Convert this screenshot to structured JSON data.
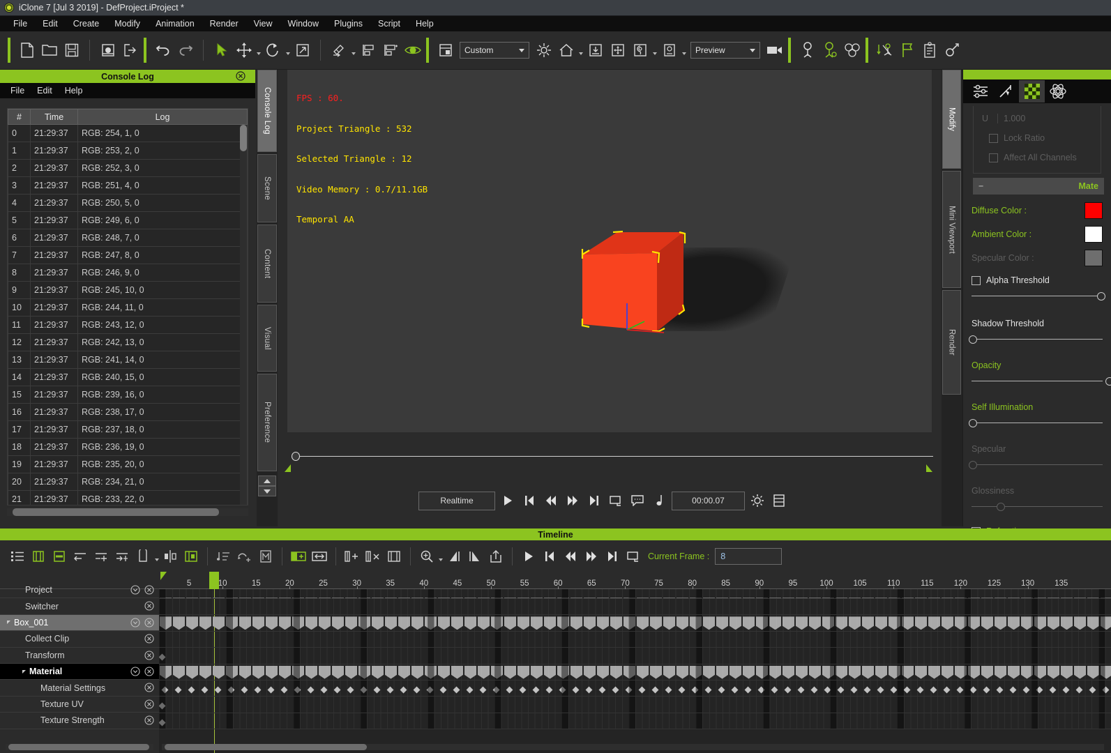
{
  "window": {
    "title": "iClone 7 [Jul  3 2019] - DefProject.iProject *",
    "app_icon": "iclone-logo-icon"
  },
  "menubar": {
    "items": [
      "File",
      "Edit",
      "Create",
      "Modify",
      "Animation",
      "Render",
      "View",
      "Window",
      "Plugins",
      "Script",
      "Help"
    ]
  },
  "toolbar": {
    "groups": [
      {
        "icons": [
          "new-project-icon",
          "open-project-icon",
          "save-project-icon"
        ]
      },
      {
        "icons": [
          "import-icon",
          "export-icon"
        ]
      },
      {
        "icons": [
          "undo-icon",
          "redo-icon"
        ]
      },
      {
        "icons": [
          "select-tool-icon",
          "move-tool-icon",
          "rotate-tool-icon",
          "scale-tool-icon"
        ]
      },
      {
        "icons": [
          "align-icon",
          "align-left-icon",
          "align-right-icon",
          "eye-visibility-icon"
        ]
      },
      {
        "icons": [
          "viewport-layout-icon"
        ]
      }
    ],
    "layout_combo": {
      "value": "Custom",
      "caret": "chevron-down-icon"
    },
    "right_icons": [
      "light-icon",
      "home-icon",
      "ground-icon",
      "move-to-icon",
      "camera-view-icon",
      "object-icon"
    ],
    "quality_combo": {
      "value": "Preview",
      "caret": "chevron-down-icon"
    },
    "camera_icon": "video-camera-icon",
    "tail_icons": [
      "character-icon",
      "character-pose-icon",
      "crowd-icon",
      "motion-puppet-icon",
      "flag-icon",
      "clipboard-icon",
      "edit-motion-icon"
    ]
  },
  "console": {
    "title": "Console Log",
    "close_icon": "close-circle-icon",
    "menu": [
      "File",
      "Edit",
      "Help"
    ],
    "columns": [
      "#",
      "Time",
      "Log"
    ],
    "rows": [
      {
        "n": "0",
        "time": "21:29:37",
        "log": "RGB: 254, 1, 0"
      },
      {
        "n": "1",
        "time": "21:29:37",
        "log": "RGB: 253, 2, 0"
      },
      {
        "n": "2",
        "time": "21:29:37",
        "log": "RGB: 252, 3, 0"
      },
      {
        "n": "3",
        "time": "21:29:37",
        "log": "RGB: 251, 4, 0"
      },
      {
        "n": "4",
        "time": "21:29:37",
        "log": "RGB: 250, 5, 0"
      },
      {
        "n": "5",
        "time": "21:29:37",
        "log": "RGB: 249, 6, 0"
      },
      {
        "n": "6",
        "time": "21:29:37",
        "log": "RGB: 248, 7, 0"
      },
      {
        "n": "7",
        "time": "21:29:37",
        "log": "RGB: 247, 8, 0"
      },
      {
        "n": "8",
        "time": "21:29:37",
        "log": "RGB: 246, 9, 0"
      },
      {
        "n": "9",
        "time": "21:29:37",
        "log": "RGB: 245, 10, 0"
      },
      {
        "n": "10",
        "time": "21:29:37",
        "log": "RGB: 244, 11, 0"
      },
      {
        "n": "11",
        "time": "21:29:37",
        "log": "RGB: 243, 12, 0"
      },
      {
        "n": "12",
        "time": "21:29:37",
        "log": "RGB: 242, 13, 0"
      },
      {
        "n": "13",
        "time": "21:29:37",
        "log": "RGB: 241, 14, 0"
      },
      {
        "n": "14",
        "time": "21:29:37",
        "log": "RGB: 240, 15, 0"
      },
      {
        "n": "15",
        "time": "21:29:37",
        "log": "RGB: 239, 16, 0"
      },
      {
        "n": "16",
        "time": "21:29:37",
        "log": "RGB: 238, 17, 0"
      },
      {
        "n": "17",
        "time": "21:29:37",
        "log": "RGB: 237, 18, 0"
      },
      {
        "n": "18",
        "time": "21:29:37",
        "log": "RGB: 236, 19, 0"
      },
      {
        "n": "19",
        "time": "21:29:37",
        "log": "RGB: 235, 20, 0"
      },
      {
        "n": "20",
        "time": "21:29:37",
        "log": "RGB: 234, 21, 0"
      },
      {
        "n": "21",
        "time": "21:29:37",
        "log": "RGB: 233, 22, 0"
      }
    ]
  },
  "left_tabs": {
    "items": [
      "Console Log",
      "Scene",
      "Content",
      "Visual",
      "Preference"
    ],
    "active": "Console Log",
    "scroll_up_icon": "chevron-up-icon",
    "scroll_down_icon": "chevron-down-icon"
  },
  "viewport": {
    "stats": {
      "fps": "FPS : 60.",
      "project_triangle": "Project Triangle : 532",
      "selected_triangle": "Selected Triangle : 12",
      "video_memory": "Video Memory : 0.7/11.1GB",
      "aa": "Temporal AA"
    },
    "object": {
      "name": "Box_001",
      "face_front_color": "#f9431f",
      "face_top_color": "#e03418",
      "face_right_color": "#c02a14",
      "selection_bracket_color": "#ffe400"
    },
    "gizmo": {
      "x_axis_color": "#e02020",
      "y_axis_color": "#20c020",
      "z_axis_color": "#3040f0"
    }
  },
  "transport": {
    "mode_label": "Realtime",
    "buttons": [
      "play-icon",
      "jump-to-start-icon",
      "step-back-icon",
      "step-forward-icon",
      "jump-to-end-icon",
      "loop-icon",
      "comment-icon",
      "audio-note-icon"
    ],
    "time_value": "00:00.07",
    "settings_icon": "gear-icon",
    "list-icon": "list-icon"
  },
  "right_tabs": {
    "items": [
      "Modify",
      "Mini Viewport",
      "Render"
    ],
    "active": "Modify"
  },
  "right_panel": {
    "icon_tabs": [
      {
        "name": "attribute-icon",
        "active": false
      },
      {
        "name": "animation-icon",
        "active": false
      },
      {
        "name": "material-icon",
        "active": true
      },
      {
        "name": "physics-icon",
        "active": false
      }
    ],
    "uv": {
      "label": "U",
      "value": "1.000"
    },
    "lock_ratio": {
      "label": "Lock Ratio",
      "checked": false,
      "enabled": false
    },
    "affect_all_channels": {
      "label": "Affect All Channels",
      "checked": false,
      "enabled": false
    },
    "material_section": {
      "collapse": "−",
      "title": "Mate"
    },
    "diffuse_color": {
      "label": "Diffuse Color :",
      "color": "#ff0000",
      "enabled": true
    },
    "ambient_color": {
      "label": "Ambient Color :",
      "color": "#ffffff",
      "enabled": true
    },
    "specular_color": {
      "label": "Specular Color :",
      "color": "#6e6e6e",
      "enabled": false
    },
    "alpha_threshold": {
      "label": "Alpha Threshold",
      "checked": false,
      "enabled": true,
      "knob_pct": 100
    },
    "shadow_threshold": {
      "label": "Shadow Threshold",
      "enabled": true,
      "knob_pct": 0
    },
    "opacity": {
      "label": "Opacity",
      "enabled": true,
      "knob_pct": 100
    },
    "self_illumination": {
      "label": "Self Illumination",
      "enabled": true,
      "knob_pct": 0
    },
    "specular": {
      "label": "Specular",
      "enabled": false,
      "knob_pct": 0
    },
    "glossiness": {
      "label": "Glossiness",
      "enabled": false,
      "knob_pct": 24
    },
    "refraction": {
      "label": "Refraction",
      "checked": false,
      "enabled": true
    },
    "accent_green": "#8cc420"
  },
  "timeline": {
    "title": "Timeline",
    "toolbar_left_icons": [
      "track-list-icon",
      "add-track-icon",
      "collapse-track-icon",
      "shift-left-icon",
      "add-key-left-icon",
      "add-key-right-icon",
      "clip-icon",
      "split-clip-icon",
      "clip-region-icon"
    ],
    "toolbar_mid_icons": [
      "sort-keys-icon",
      "unlink-icon",
      "motion-layer-icon"
    ],
    "toolbar_mid2_icons": [
      "add-clip-icon",
      "stretch-clip-icon",
      "insert-frame-icon",
      "delete-frame-icon",
      "split-frame-icon"
    ],
    "toolbar_zoom_icons": [
      "zoom-icon",
      "zoom-in-range-icon",
      "zoom-out-range-icon",
      "export-range-icon"
    ],
    "transport_icons": [
      "play-icon",
      "jump-to-start-icon",
      "step-back-icon",
      "step-forward-icon",
      "jump-to-end-icon",
      "loop-icon"
    ],
    "current_frame": {
      "label": "Current Frame :",
      "value": "8"
    },
    "ruler_ticks": [
      5,
      10,
      15,
      20,
      25,
      30,
      35,
      40,
      45,
      50,
      55,
      60,
      65,
      70,
      75,
      80,
      85,
      90,
      95,
      100,
      105,
      110,
      115,
      120,
      125,
      130,
      135
    ],
    "playhead_frame": 8,
    "tracks": [
      {
        "label": "Project",
        "indent": 1,
        "selected": false,
        "has_chevron": true,
        "has_close": true,
        "type": "partial",
        "clipped": true
      },
      {
        "label": "Switcher",
        "indent": 1,
        "selected": false,
        "has_chevron": false,
        "has_close": true,
        "type": "empty"
      },
      {
        "label": "Box_001",
        "indent": 0,
        "selected": true,
        "has_chevron": true,
        "has_close": true,
        "type": "clips",
        "expander": "triangle-down-icon"
      },
      {
        "label": "Collect Clip",
        "indent": 1,
        "selected": false,
        "has_chevron": false,
        "has_close": true,
        "type": "empty"
      },
      {
        "label": "Transform",
        "indent": 1,
        "selected": false,
        "has_chevron": false,
        "has_close": true,
        "type": "single-key"
      },
      {
        "label": "Material",
        "indent": 1,
        "selected": true,
        "black": true,
        "has_chevron": true,
        "has_close": true,
        "type": "clips",
        "expander": "triangle-down-icon"
      },
      {
        "label": "Material Settings",
        "indent": 2,
        "selected": false,
        "has_chevron": false,
        "has_close": true,
        "type": "keys"
      },
      {
        "label": "Texture UV",
        "indent": 2,
        "selected": false,
        "has_chevron": false,
        "has_close": true,
        "type": "single-key"
      },
      {
        "label": "Texture Strength",
        "indent": 2,
        "selected": false,
        "has_chevron": false,
        "has_close": true,
        "type": "single-key"
      }
    ]
  }
}
